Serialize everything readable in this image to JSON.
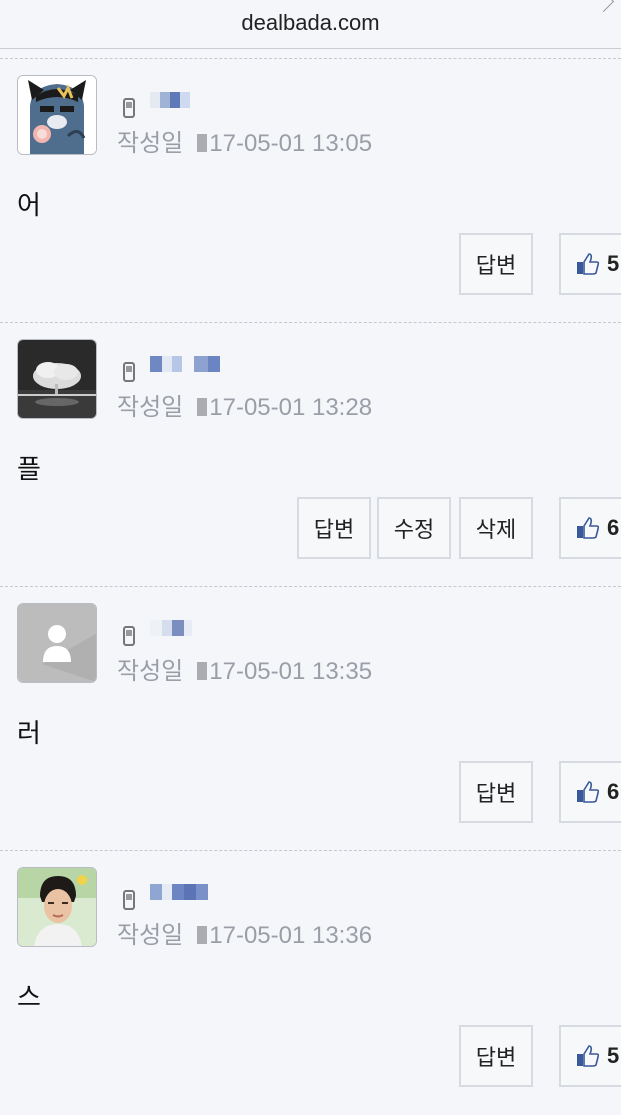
{
  "browser": {
    "url": "dealbada.com"
  },
  "comments": [
    {
      "avatar_icon": "cartoon-cat-avatar",
      "meta_label": "작성일",
      "date": "17-05-01 13:05",
      "body": "어",
      "buttons": [
        "답변"
      ],
      "likes": "5"
    },
    {
      "avatar_icon": "landscape-photo-avatar",
      "meta_label": "작성일",
      "date": "17-05-01 13:28",
      "body": "플",
      "buttons": [
        "답변",
        "수정",
        "삭제"
      ],
      "likes": "6"
    },
    {
      "avatar_icon": "default-user-avatar",
      "meta_label": "작성일",
      "date": "17-05-01 13:35",
      "body": "러",
      "buttons": [
        "답변"
      ],
      "likes": "6"
    },
    {
      "avatar_icon": "person-photo-avatar",
      "meta_label": "작성일",
      "date": "17-05-01 13:36",
      "body": "스",
      "buttons": [
        "답변"
      ],
      "likes": "5"
    }
  ]
}
